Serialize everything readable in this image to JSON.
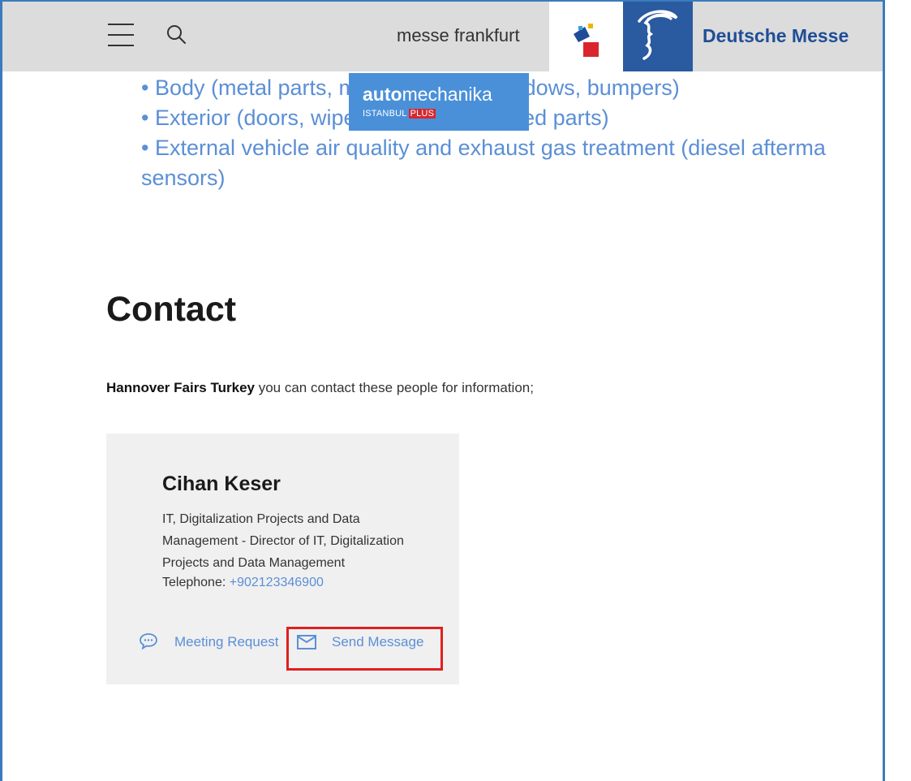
{
  "header": {
    "messe_frankfurt_label": "messe frankfurt",
    "deutsche_messe_label": "Deutsche Messe",
    "menu_icon": "hamburger-menu-icon",
    "search_icon": "search-icon"
  },
  "badge": {
    "name_bold": "auto",
    "name_rest": "mechanika",
    "sub_text": "ISTANBUL",
    "sub_plus": "PLUS"
  },
  "bullets": {
    "line1": "• Body (metal parts, mounted parts, windows, bumpers)",
    "line2": "• Exterior (doors, wiper systems, mounted parts)",
    "line3": "• External vehicle air quality and exhaust gas treatment (diesel afterma",
    "line4": "sensors)"
  },
  "contact": {
    "heading": "Contact",
    "intro_bold": "Hannover Fairs Turkey",
    "intro_rest": " you can contact these people for information;",
    "card": {
      "name": "Cihan Keser",
      "role": "IT, Digitalization Projects and Data Management - Director of IT, Digitalization Projects and Data Management",
      "phone_label": "Telephone: ",
      "phone_value": "+902123346900",
      "meeting_request": "Meeting Request",
      "send_message": "Send Message"
    }
  },
  "colors": {
    "accent": "#5b8fd6",
    "frame": "#3b7bbd",
    "deutsche_messe_blue": "#2a5aa0",
    "highlight": "#e01f1f"
  }
}
